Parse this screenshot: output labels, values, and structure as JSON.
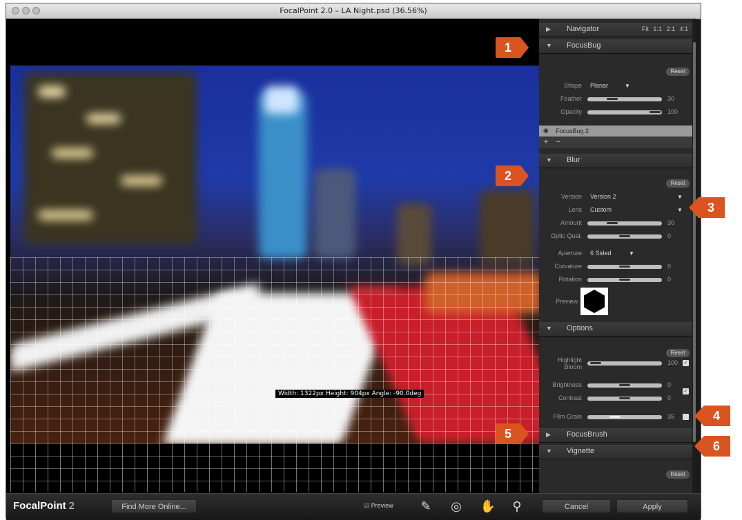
{
  "window": {
    "title": "FocalPoint 2.0 – LA Night.psd (36.56%)"
  },
  "canvas": {
    "measurement_text": "Width: 1322px Height: 904px Angle: -90.0deg"
  },
  "panel": {
    "navigator": {
      "label": "Navigator",
      "zoom_fit": "Fit",
      "zoom_1_1": "1:1",
      "zoom_2_1": "2:1",
      "zoom_4_1": "4:1"
    },
    "focusbug": {
      "label": "FocusBug",
      "reset": "Reset",
      "shape_label": "Shape",
      "shape_value": "Planar",
      "feather_label": "Feather",
      "feather_value": "30",
      "opacity_label": "Opacity",
      "opacity_value": "100",
      "layer_name": "FocusBug 2",
      "add": "+",
      "remove": "−"
    },
    "blur": {
      "label": "Blur",
      "reset": "Reset",
      "version_label": "Version",
      "version_value": "Version 2",
      "lens_label": "Lens",
      "lens_value": "Custom",
      "amount_label": "Amount",
      "amount_value": "30",
      "optic_label": "Optic Qual.",
      "optic_value": "0",
      "aperture_label": "Aperture",
      "aperture_value": "6 Sided",
      "curvature_label": "Curvature",
      "curvature_value": "0",
      "rotation_label": "Rotation",
      "rotation_value": "0",
      "preview_label": "Preview"
    },
    "options": {
      "label": "Options",
      "reset": "Reset",
      "highlight_label_1": "Highlight",
      "highlight_label_2": "Bloom",
      "highlight_value": "100",
      "brightness_label": "Brightness",
      "brightness_value": "0",
      "contrast_label": "Contrast",
      "contrast_value": "0",
      "filmgrain_label": "Film Grain",
      "filmgrain_value": "35"
    },
    "focusbrush": {
      "label": "FocusBrush"
    },
    "vignette": {
      "label": "Vignette",
      "reset": "Reset"
    }
  },
  "bottombar": {
    "logo_text": "FocalPoint",
    "logo_version": "2",
    "find_more": "Find More Online...",
    "preview_label": "Preview",
    "cancel": "Cancel",
    "apply": "Apply"
  },
  "callouts": [
    "1",
    "2",
    "3",
    "4",
    "5",
    "6"
  ],
  "colors": {
    "callout": "#d9541f",
    "panel_bg": "#2a2a2a",
    "sky": "#1f3aa8"
  },
  "icons": [
    "brush-icon",
    "focusbug-tool-icon",
    "hand-icon",
    "zoom-icon",
    "eye-icon"
  ]
}
